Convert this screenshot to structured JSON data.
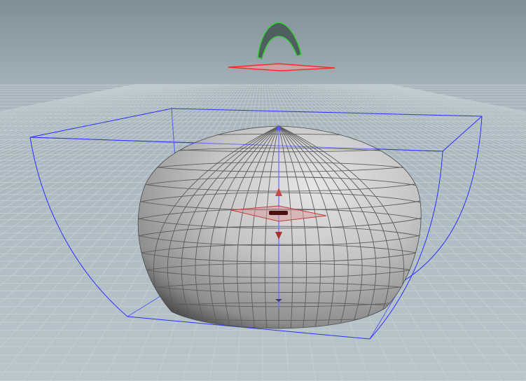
{
  "viewport": {
    "background_top": "#7f8f98",
    "background_horizon": "#a7b4bb",
    "background_bottom": "#b8c6cc",
    "grid_color": "#c8d3d8"
  },
  "scene": {
    "objects": [
      {
        "name": "deformed-sphere",
        "kind": "polygon-mesh",
        "color": "#b9b9b9",
        "wire_color": "#5d5d5d"
      },
      {
        "name": "lattice-cage",
        "kind": "lattice-bounding-box",
        "color": "#2e2eff"
      },
      {
        "name": "curve-handle",
        "kind": "bezier-curve",
        "color": "#3ecb3e",
        "fill": "#4f5e5e"
      },
      {
        "name": "ground-plane-handle",
        "kind": "plane-handle",
        "color": "#ff2a2a"
      },
      {
        "name": "center-handle",
        "kind": "transform-handle",
        "color": "#c83a3a"
      }
    ]
  }
}
